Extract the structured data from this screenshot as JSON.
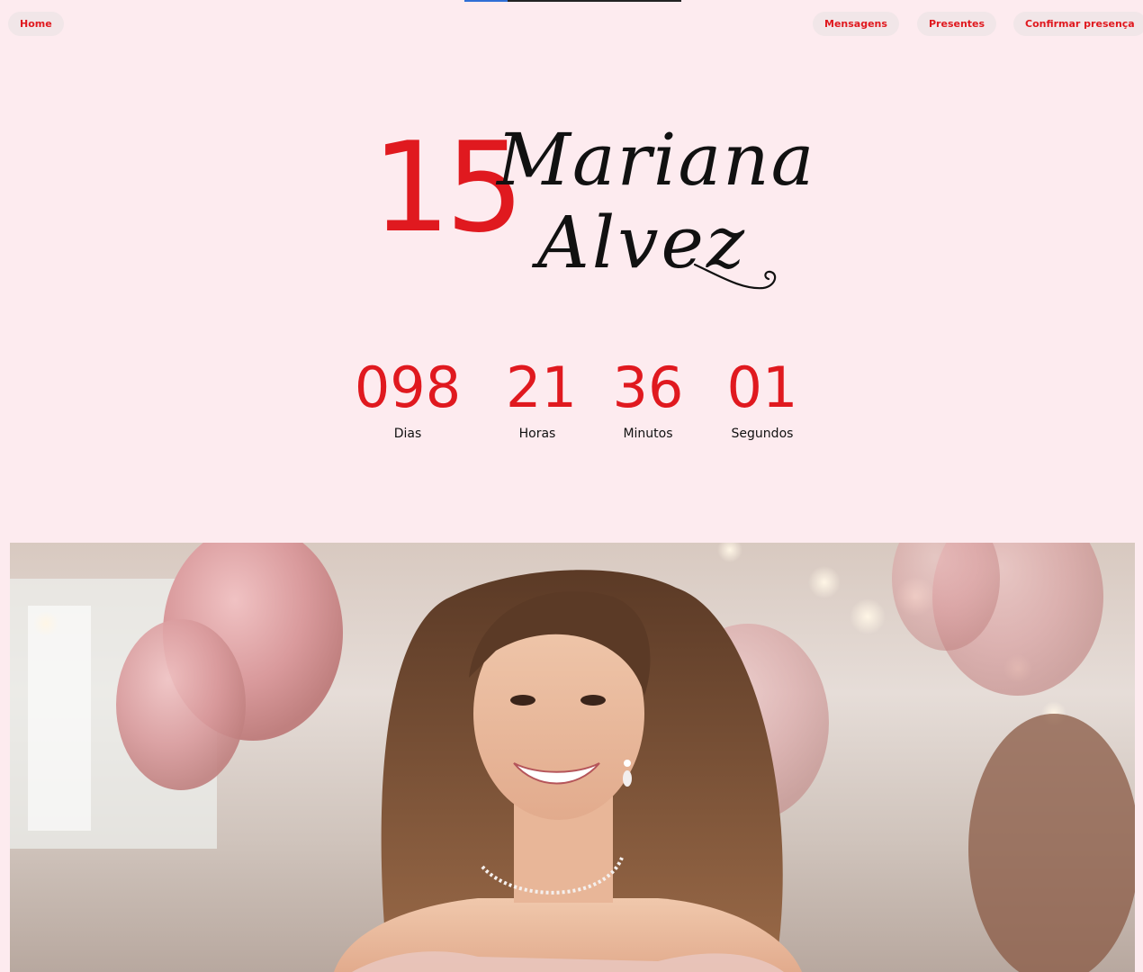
{
  "nav": {
    "home": "Home",
    "mensagens": "Mensagens",
    "presentes": "Presentes",
    "confirmar": "Confirmar presença"
  },
  "hero": {
    "number": "15",
    "first_name": "Mariana",
    "last_name": "Alvez"
  },
  "countdown": {
    "days": {
      "value": "098",
      "label": "Dias"
    },
    "hours": {
      "value": "21",
      "label": "Horas"
    },
    "minutes": {
      "value": "36",
      "label": "Minutos"
    },
    "seconds": {
      "value": "01",
      "label": "Segundos"
    }
  },
  "colors": {
    "background": "#fdebef",
    "accent": "#e0191f",
    "text": "#111111",
    "pill": "#f1e6e8"
  },
  "loading_progress": 0.2
}
